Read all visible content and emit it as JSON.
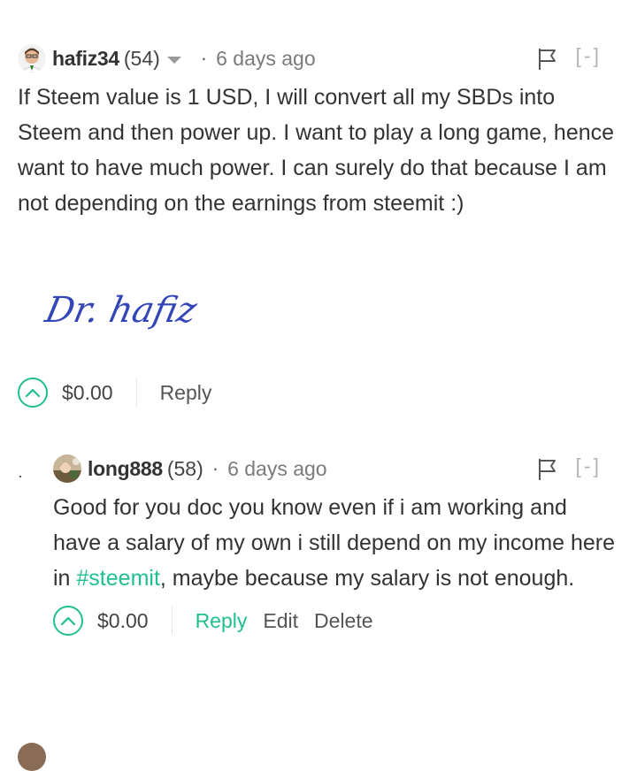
{
  "comments": [
    {
      "author": "hafiz34",
      "reputation": "(54)",
      "time": "6 days ago",
      "collapse": "[-]",
      "body": "If Steem value is 1 USD, I will convert all my SBDs into Steem and then power up. I want to play a long game, hence want to have much power. I can surely do that because I am not depending on the earnings from steemit :)",
      "signature": "Dr. hafiz",
      "payout": "$0.00",
      "reply": "Reply"
    },
    {
      "author": "long888",
      "reputation": "(58)",
      "time": "6 days ago",
      "collapse": "[-]",
      "body_before": "Good for you doc you know even if i am working and have a salary of my own i still depend on my income here in ",
      "tag": "#steemit",
      "body_after": ", maybe because my salary is not enough.",
      "payout": "$0.00",
      "reply": "Reply",
      "edit": "Edit",
      "delete": "Delete"
    }
  ],
  "colors": {
    "accent": "#1fbf8f",
    "text": "#333333",
    "muted": "#7b7b7b"
  }
}
